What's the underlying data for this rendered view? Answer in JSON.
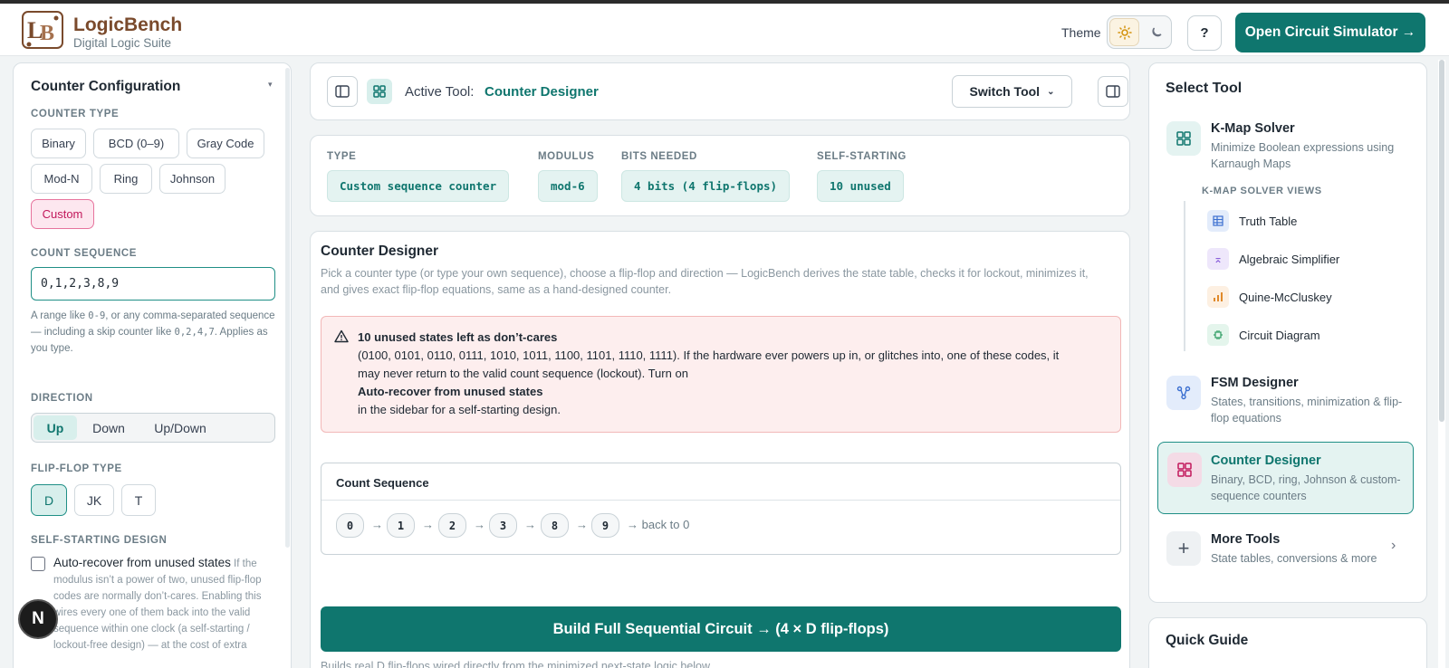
{
  "header": {
    "brand": "LogicBench",
    "subtitle": "Digital Logic Suite",
    "theme_label": "Theme",
    "help_label": "?",
    "open_simulator": "Open Circuit Simulator →"
  },
  "sidebar": {
    "title": "Counter Configuration",
    "counter_type_label": "COUNTER TYPE",
    "counter_types": [
      "Binary",
      "BCD (0–9)",
      "Gray Code",
      "Mod-N",
      "Ring",
      "Johnson",
      "Custom"
    ],
    "selected_type": "Custom",
    "count_sequence_label": "COUNT SEQUENCE",
    "count_sequence_value": "0,1,2,3,8,9",
    "help_parts": [
      "A range like ",
      "0-9",
      ", or any comma-separated sequence — including a skip counter like ",
      "0,2,4,7",
      ". Applies as you type."
    ],
    "direction_label": "DIRECTION",
    "directions": [
      "Up",
      "Down",
      "Up/Down"
    ],
    "selected_direction": "Up",
    "flipflop_label": "FLIP-FLOP TYPE",
    "flipflops": [
      "D",
      "JK",
      "T"
    ],
    "selected_flipflop": "D",
    "self_start_label": "SELF-STARTING DESIGN",
    "auto_recover_label": "Auto-recover from unused states",
    "auto_recover_checked": false,
    "auto_recover_help": "If the modulus isn’t a power of two, unused flip-flop codes are normally don’t-cares. Enabling this wires every one of them back into the valid sequence within one clock (a self-starting / lockout-free design) — at the cost of extra",
    "bubble_label": "N"
  },
  "toolbar": {
    "active_tool_label": "Active Tool:",
    "active_tool": "Counter Designer",
    "switch_tool": "Switch Tool"
  },
  "stats": [
    {
      "label": "TYPE",
      "value": "Custom sequence counter"
    },
    {
      "label": "MODULUS",
      "value": "mod-6"
    },
    {
      "label": "BITS NEEDED",
      "value": "4 bits (4 flip-flops)"
    },
    {
      "label": "SELF-STARTING",
      "value": "10 unused"
    }
  ],
  "designer": {
    "title": "Counter Designer",
    "description": "Pick a counter type (or type your own sequence), choose a flip-flop and direction — LogicBench derives the state table, checks it for lockout, minimizes it, and gives exact flip-flop equations, same as a hand-designed counter.",
    "alert_title": "10 unused states left as don’t-cares",
    "alert_body": "(0100, 0101, 0110, 0111, 1010, 1011, 1100, 1101, 1110, 1111). If the hardware ever powers up in, or glitches into, one of these codes, it may never return to the valid count sequence (lockout). Turn on",
    "alert_bold": "Auto-recover from unused states",
    "alert_tail": "in the sidebar for a self-starting design.",
    "sequence_title": "Count Sequence",
    "sequence": [
      "0",
      "1",
      "2",
      "3",
      "8",
      "9"
    ],
    "arrow": "→",
    "back_label": "→ back to 0",
    "build_button": "Build Full Sequential Circuit → (4 × D flip-flops)",
    "build_caption": "Builds real D flip-flops wired directly from the minimized next-state logic below."
  },
  "tools": {
    "title": "Select Tool",
    "kmap": {
      "name": "K-Map Solver",
      "desc": "Minimize Boolean expressions using Karnaugh Maps"
    },
    "kmap_views_label": "K-MAP SOLVER VIEWS",
    "kmap_views": [
      "Truth Table",
      "Algebraic Simplifier",
      "Quine-McCluskey",
      "Circuit Diagram"
    ],
    "fsm": {
      "name": "FSM Designer",
      "desc": "States, transitions, minimization & flip-flop equations"
    },
    "counter": {
      "name": "Counter Designer",
      "desc": "Binary, BCD, ring, Johnson & custom-sequence counters"
    },
    "more": {
      "name": "More Tools",
      "desc": "State tables, conversions & more"
    },
    "quick_guide": "Quick Guide"
  },
  "colors": {
    "accent": "#0f766e",
    "brand": "#7a4a2c",
    "counter_pink": "#c2185b",
    "alert_bg": "#fdeeee"
  }
}
